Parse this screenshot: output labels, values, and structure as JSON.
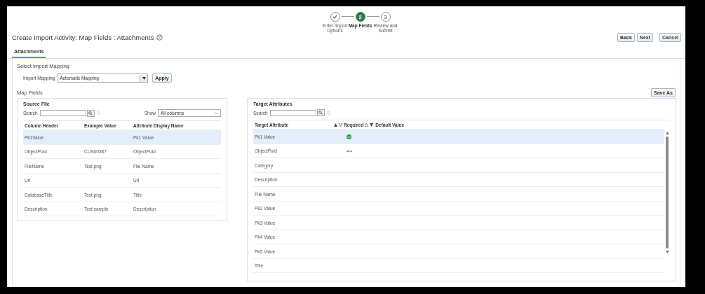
{
  "steps": [
    {
      "label": "Enter Import Options",
      "completed": true,
      "selected": false
    },
    {
      "number": "2",
      "label": "Map Fields",
      "completed": false,
      "selected": true
    },
    {
      "number": "3",
      "label": "Review and Submit",
      "completed": false,
      "selected": false
    }
  ],
  "title": "Create Import Activity: Map Fields : Attachments",
  "buttons": [
    "Back",
    "Next",
    "Cancel"
  ],
  "tabs": [
    {
      "label": "Attachments",
      "selected": true
    }
  ],
  "import_mapping": {
    "heading": "Select Import Mapping",
    "label": "Import Mapping",
    "value": "Automatic Mapping",
    "apply": "Apply"
  },
  "map_fields": {
    "heading": "Map Fields",
    "save_as": "Save As"
  },
  "source_file": {
    "title": "Source File",
    "search_label": "Search",
    "show_label": "Show",
    "show_value": "All columns",
    "columns": [
      "Column Header",
      "Example Value",
      "Attribute Display Name"
    ],
    "rows": [
      {
        "cells": [
          "Pk1Value",
          "",
          "Pk1 Value"
        ],
        "selected": true
      },
      {
        "cells": [
          "ObjectPuid",
          "CUS00587",
          "ObjectPuid"
        ],
        "selected": false
      },
      {
        "cells": [
          "FileName",
          "Test.png",
          "File Name"
        ],
        "selected": false
      },
      {
        "cells": [
          "Url",
          "",
          "Url"
        ],
        "selected": false
      },
      {
        "cells": [
          "DatabaseTitle",
          "Test.png",
          "Title"
        ],
        "selected": false
      },
      {
        "cells": [
          "Description",
          "Test sample",
          "Description"
        ],
        "selected": false
      }
    ]
  },
  "target_attributes": {
    "title": "Target Attributes",
    "search_label": "Search",
    "columns": [
      "Target Attribute",
      "Required",
      "Default Value"
    ],
    "rows": [
      {
        "name": "Pk1 Value",
        "kind": "check",
        "selected": true
      },
      {
        "name": "ObjectPuid",
        "kind": "key",
        "selected": false
      },
      {
        "name": "Category",
        "kind": "plain",
        "selected": false
      },
      {
        "name": "Description",
        "kind": "plain",
        "selected": false
      },
      {
        "name": "File Name",
        "kind": "plain",
        "selected": false
      },
      {
        "name": "Pk2 Value",
        "kind": "plain",
        "selected": false
      },
      {
        "name": "Pk3 Value",
        "kind": "plain",
        "selected": false
      },
      {
        "name": "Pk4 Value",
        "kind": "plain",
        "selected": false
      },
      {
        "name": "Pk5 Value",
        "kind": "plain",
        "selected": false
      },
      {
        "name": "Title",
        "kind": "plain",
        "selected": false
      }
    ]
  }
}
